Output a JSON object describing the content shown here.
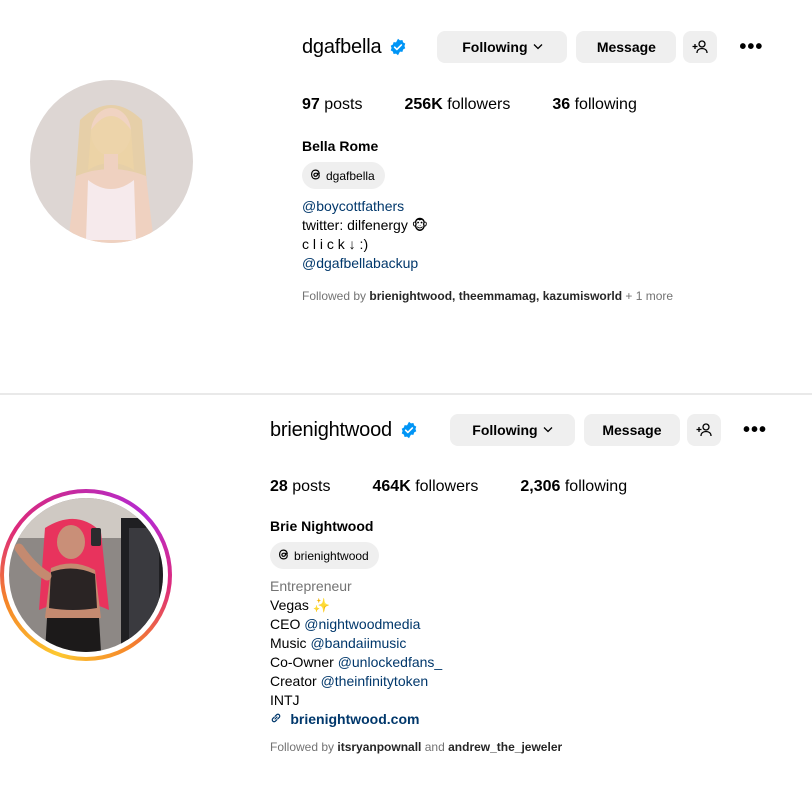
{
  "profiles": [
    {
      "username": "dgafbella",
      "buttons": {
        "following": "Following",
        "message": "Message"
      },
      "stats": {
        "posts_count": "97",
        "posts_label": "posts",
        "followers_count": "256K",
        "followers_label": "followers",
        "following_count": "36",
        "following_label": "following"
      },
      "full_name": "Bella Rome",
      "threads_handle": "dgafbella",
      "bio": [
        {
          "text": "@boycottfathers",
          "type": "link"
        },
        {
          "text": "twitter: dilfenergy 🐵",
          "type": "text"
        },
        {
          "text": "c l i c k ↓ :)",
          "type": "text"
        },
        {
          "text": "@dgafbellabackup",
          "type": "link"
        }
      ],
      "followed_by": {
        "prefix": "Followed by ",
        "names": "brienightwood, theemmamag, kazumisworld",
        "suffix": " + 1 more"
      }
    },
    {
      "username": "brienightwood",
      "buttons": {
        "following": "Following",
        "message": "Message"
      },
      "stats": {
        "posts_count": "28",
        "posts_label": "posts",
        "followers_count": "464K",
        "followers_label": "followers",
        "following_count": "2,306",
        "following_label": "following"
      },
      "full_name": "Brie Nightwood",
      "threads_handle": "brienightwood",
      "category": "Entrepreneur",
      "bio": [
        {
          "prefix": "Vegas ✨",
          "link": ""
        },
        {
          "prefix": "CEO ",
          "link": "@nightwoodmedia"
        },
        {
          "prefix": "Music ",
          "link": "@bandaiimusic"
        },
        {
          "prefix": "Co-Owner ",
          "link": "@unlockedfans_"
        },
        {
          "prefix": "Creator ",
          "link": "@theinfinitytoken"
        },
        {
          "prefix": "INTJ",
          "link": ""
        }
      ],
      "external_link": "brienightwood.com",
      "followed_by": {
        "prefix": "Followed by ",
        "name1": "itsryanpownall",
        "and": " and ",
        "name2": "andrew_the_jeweler"
      }
    }
  ],
  "icons": {
    "verified": "verified-badge-icon",
    "threads": "threads-icon",
    "add_user": "add-user-icon",
    "more": "more-options-icon",
    "chevron": "chevron-down-icon",
    "link": "link-chain-icon"
  },
  "colors": {
    "verified_blue": "#0095f6",
    "link_blue": "#00376b",
    "button_gray": "#efefef",
    "secondary_text": "#737373"
  }
}
